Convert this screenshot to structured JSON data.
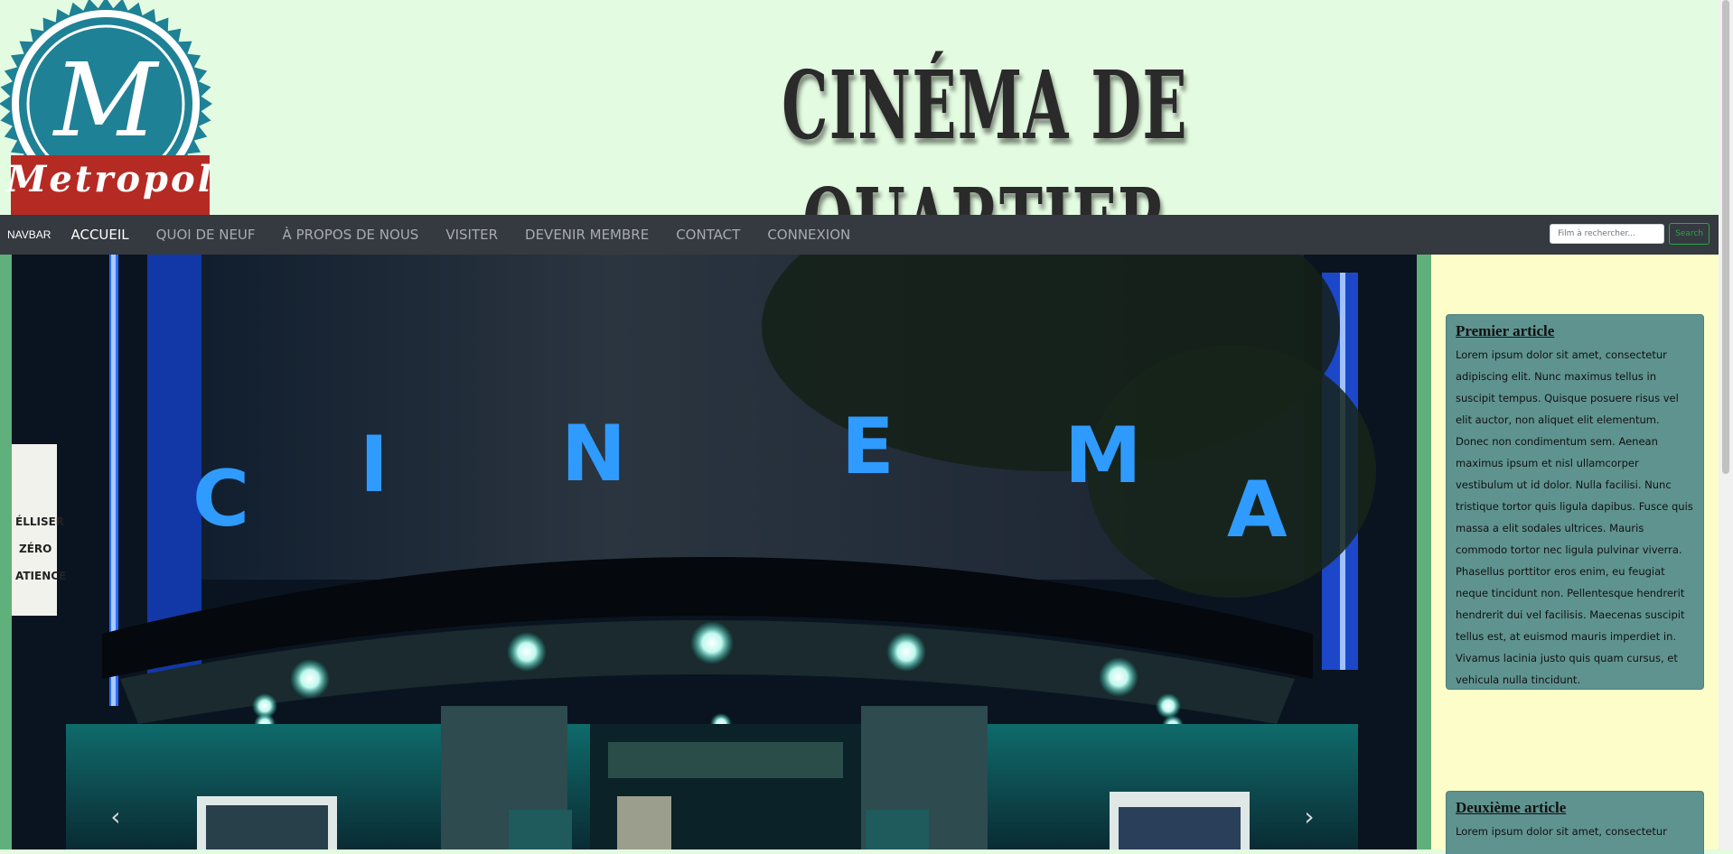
{
  "header": {
    "title": "CINÉMA DE QUARTIER",
    "logo": {
      "letter": "M",
      "name": "Metropol",
      "colors": {
        "ring": "#1f8196",
        "banner": "#b52b24"
      }
    }
  },
  "navbar": {
    "brand": "NAVBAR",
    "links": [
      "ACCUEIL",
      "QUOI DE NEUF",
      "À PROPOS DE NOUS",
      "VISITER",
      "DEVENIR MEMBRE",
      "CONTACT",
      "CONNEXION"
    ],
    "active_index": 0,
    "search": {
      "placeholder": "Film à rechercher...",
      "value": "",
      "button": "Search"
    }
  },
  "carousel": {
    "sign_letters": [
      "C",
      "I",
      "N",
      "E",
      "M",
      "A"
    ],
    "poster_lines": [
      "ÉLLISER",
      "ZÉRO",
      "ATIENCE"
    ],
    "prev_icon": "chevron-left-icon",
    "next_icon": "chevron-right-icon"
  },
  "articles": [
    {
      "title": "Premier article",
      "body": "Lorem ipsum dolor sit amet, consectetur adipiscing elit. Nunc maximus tellus in suscipit tempus. Quisque posuere risus vel elit auctor, non aliquet elit elementum. Donec non condimentum sem. Aenean maximus ipsum et nisl ullamcorper vestibulum ut id dolor. Nulla facilisi. Nunc tristique tortor quis ligula dapibus. Fusce quis massa a elit sodales ultrices. Mauris commodo tortor nec ligula pulvinar viverra. Phasellus porttitor eros enim, eu feugiat neque tincidunt non. Pellentesque hendrerit hendrerit dui vel facilisis. Maecenas suscipit tellus est, at euismod mauris imperdiet in. Vivamus lacinia justo quis quam cursus, et vehicula nulla tincidunt."
    },
    {
      "title": "Deuxième article",
      "body": "Lorem ipsum dolor sit amet, consectetur"
    }
  ],
  "colors": {
    "page_bg": "#e3fbe0",
    "navbar_bg": "#343a40",
    "side_strip": "#5fb07a",
    "sidebar_bg": "#fdfdc9",
    "article_bg": "#5f9390",
    "search_accent": "#28a745"
  }
}
